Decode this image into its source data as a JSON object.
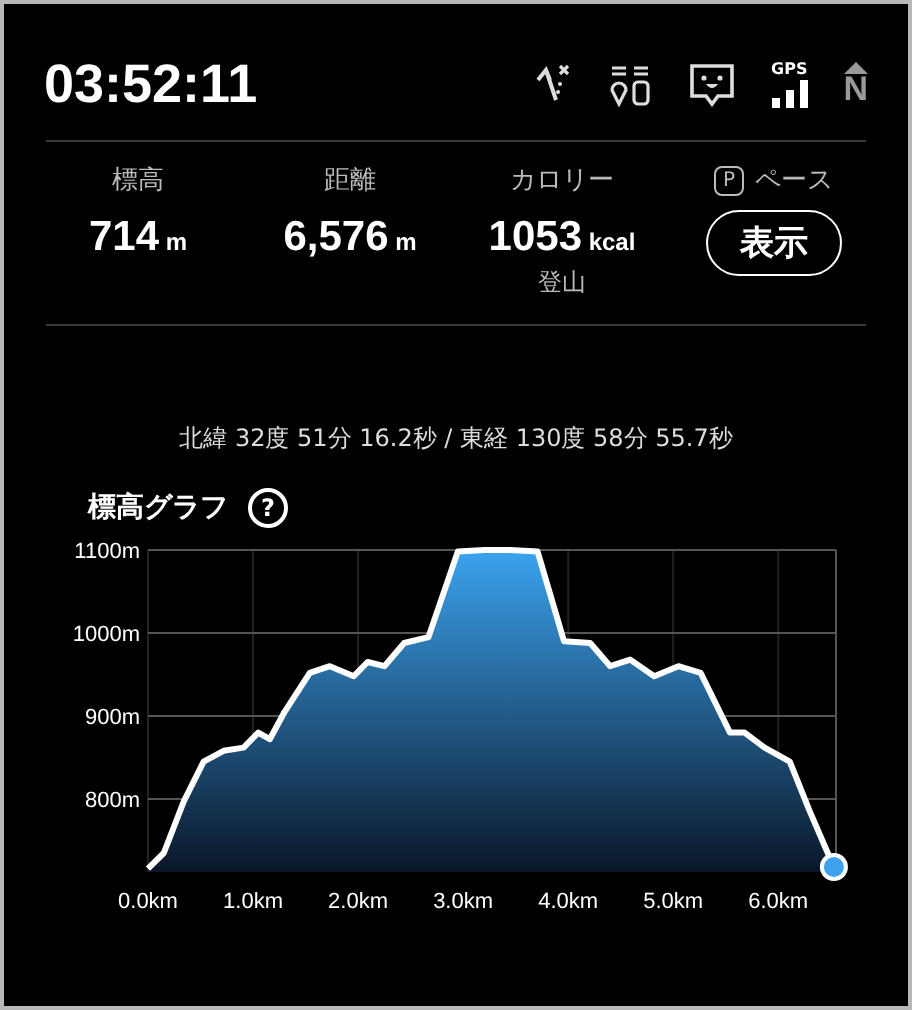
{
  "header": {
    "time": "03:52:11",
    "gps_label": "GPS",
    "compass_label": "N"
  },
  "stats": [
    {
      "label": "標高",
      "value": "714",
      "unit": "m"
    },
    {
      "label": "距離",
      "value": "6,576",
      "unit": "m"
    },
    {
      "label": "カロリー",
      "value": "1053",
      "unit": "kcal",
      "note": "登山"
    }
  ],
  "pace": {
    "badge": "P",
    "label": "ペース",
    "button": "表示"
  },
  "coordinates": "北緯 32度 51分 16.2秒 / 東経 130度 58分 55.7秒",
  "graph": {
    "title": "標高グラフ",
    "help": "?",
    "chart_data": {
      "type": "area",
      "xlim": [
        0,
        6.55
      ],
      "ylim": [
        712,
        1100
      ],
      "xticks": [
        {
          "value": 0,
          "label": "0.0km"
        },
        {
          "value": 1,
          "label": "1.0km"
        },
        {
          "value": 2,
          "label": "2.0km"
        },
        {
          "value": 3,
          "label": "3.0km"
        },
        {
          "value": 4,
          "label": "4.0km"
        },
        {
          "value": 5,
          "label": "5.0km"
        },
        {
          "value": 6,
          "label": "6.0km"
        }
      ],
      "yticks": [
        {
          "value": 800,
          "label": "800m"
        },
        {
          "value": 900,
          "label": "900m"
        },
        {
          "value": 1000,
          "label": "1000m"
        },
        {
          "value": 1100,
          "label": "1100m"
        }
      ],
      "x": [
        0,
        0.15,
        0.34,
        0.53,
        0.72,
        0.91,
        1.05,
        1.16,
        1.3,
        1.54,
        1.73,
        1.96,
        2.09,
        2.25,
        2.44,
        2.67,
        2.95,
        3.2,
        3.45,
        3.71,
        3.96,
        4.21,
        4.4,
        4.59,
        4.82,
        5.05,
        5.26,
        5.54,
        5.68,
        5.87,
        6.11,
        6.3,
        6.53
      ],
      "grid": true,
      "series": [
        {
          "color": "#ffffff",
          "values": [
            716,
            735,
            797,
            845,
            858,
            862,
            880,
            872,
            905,
            952,
            960,
            948,
            965,
            960,
            988,
            995,
            1098,
            1100,
            1100,
            1098,
            990,
            988,
            960,
            968,
            948,
            960,
            952,
            880,
            880,
            862,
            845,
            785,
            718
          ]
        }
      ]
    }
  }
}
